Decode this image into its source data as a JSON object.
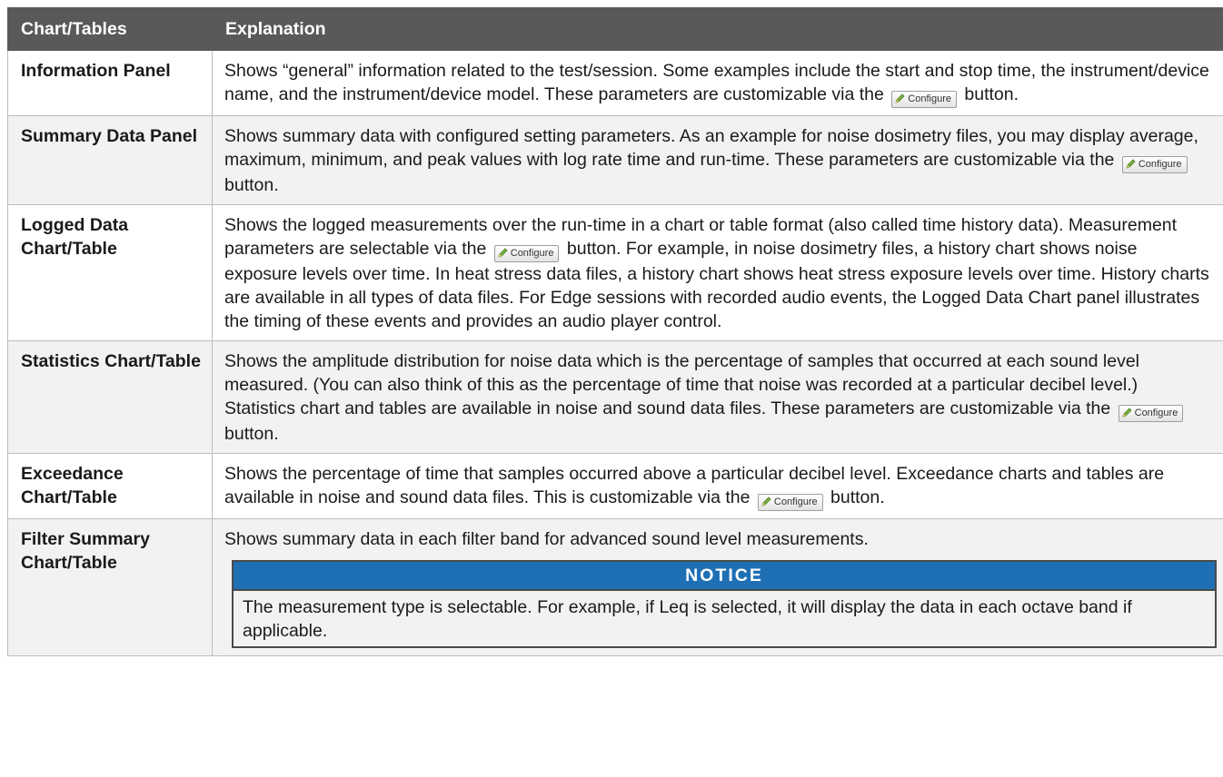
{
  "table": {
    "headers": [
      "Chart/Tables",
      "Explanation"
    ],
    "configure_label": "Configure",
    "rows": [
      {
        "name": "Information Panel",
        "text_before": "Shows “general” information related to the test/session. Some examples include the start and stop time, the instrument/device name, and the instrument/device model. These parameters are customizable via the",
        "text_after": "button."
      },
      {
        "name": "Summary Data Panel",
        "text_before": "Shows summary data with configured setting parameters. As an example for noise dosimetry files, you may display average, maximum, minimum, and peak values with log rate time and run-time. These parameters are customizable via the",
        "text_after": "button."
      },
      {
        "name": "Logged Data Chart/Table",
        "text_before": "Shows the logged measurements over the run-time in a chart or table format (also called time history data). Measurement parameters are selectable via the",
        "text_after": "button. For example, in noise dosimetry files, a history chart shows noise exposure levels over time. In heat stress data files, a history chart shows heat stress exposure levels over time. History charts are available in all types of data files. For Edge sessions with recorded audio events, the Logged Data Chart panel illustrates the timing of these events and provides an audio player control."
      },
      {
        "name": "Statistics Chart/Table",
        "text_before": "Shows the amplitude distribution for noise data which is the percentage of samples that occurred at each sound level measured. (You can also think of this as the percentage of time that noise was recorded at a particular decibel level.) Statistics chart and tables are available in noise and sound data files. These parameters are customizable via the",
        "text_after": "button."
      },
      {
        "name": "Exceedance Chart/Table",
        "text_before": "Shows the percentage of time that samples occurred above a particular decibel level. Exceedance charts and tables are available in noise and sound data files. This is customizable via the",
        "text_after": "button."
      },
      {
        "name": "Filter Summary Chart/Table",
        "text": "Shows summary data in each filter band for advanced sound level measurements.",
        "notice": {
          "title": "NOTICE",
          "body": "The measurement type is selectable. For example, if Leq is selected, it will display the data in each octave band if applicable."
        }
      }
    ]
  },
  "colors": {
    "header_bg": "#595959",
    "alt_row_bg": "#f2f2f2",
    "notice_bg": "#1f6fb5"
  },
  "icons": {
    "configure": "pencil-icon"
  }
}
